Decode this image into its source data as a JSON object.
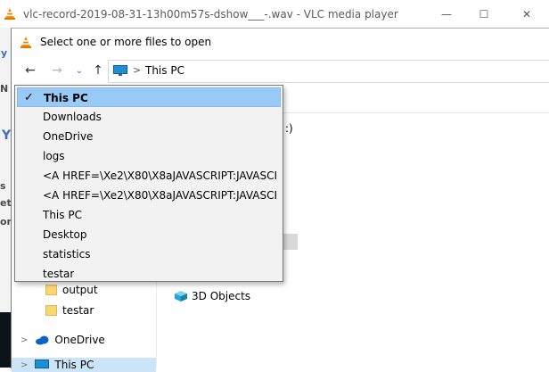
{
  "vlc_window": {
    "title": "vlc-record-2019-08-31-13h00m57s-dshow___-.wav - VLC media player",
    "controls": {
      "minimize": "—",
      "maximize": "☐",
      "close": "✕"
    },
    "ghost_chars": [
      "y",
      "N",
      "Y",
      "s",
      "et",
      "or"
    ]
  },
  "dialog": {
    "title": "Select one or more files to open",
    "address": {
      "separator": ">",
      "location": "This PC"
    },
    "nav_icons": {
      "back": "←",
      "forward": "→",
      "recent": "⌄",
      "up": "↑"
    },
    "drive_fragment": ":)",
    "tree": [
      {
        "label": "output",
        "icon": "folder-icon"
      },
      {
        "label": "testar",
        "icon": "folder-icon"
      },
      {
        "label": "OneDrive",
        "icon": "cloud-icon",
        "chevron": ">"
      },
      {
        "label": "This PC",
        "icon": "pc-icon",
        "chevron": ">"
      }
    ],
    "content": {
      "obj3d_label": "3D Objects"
    }
  },
  "dropdown": {
    "selected_index": 0,
    "check": "✓",
    "items": [
      "This PC",
      "Downloads",
      "OneDrive",
      "logs",
      "<A HREF=\\Xe2\\X80\\X8aJAVASCRIPT:JAVASCRI",
      "<A HREF=\\Xe2\\X80\\X8aJAVASCRIPT:JAVASCRI",
      "This PC",
      "Desktop",
      "statistics",
      "testar"
    ]
  },
  "colors": {
    "selection": "#99c9f5",
    "vlc_orange": "#f08a00",
    "folder": "#f8d775",
    "onedrive_blue": "#0a64c8"
  }
}
